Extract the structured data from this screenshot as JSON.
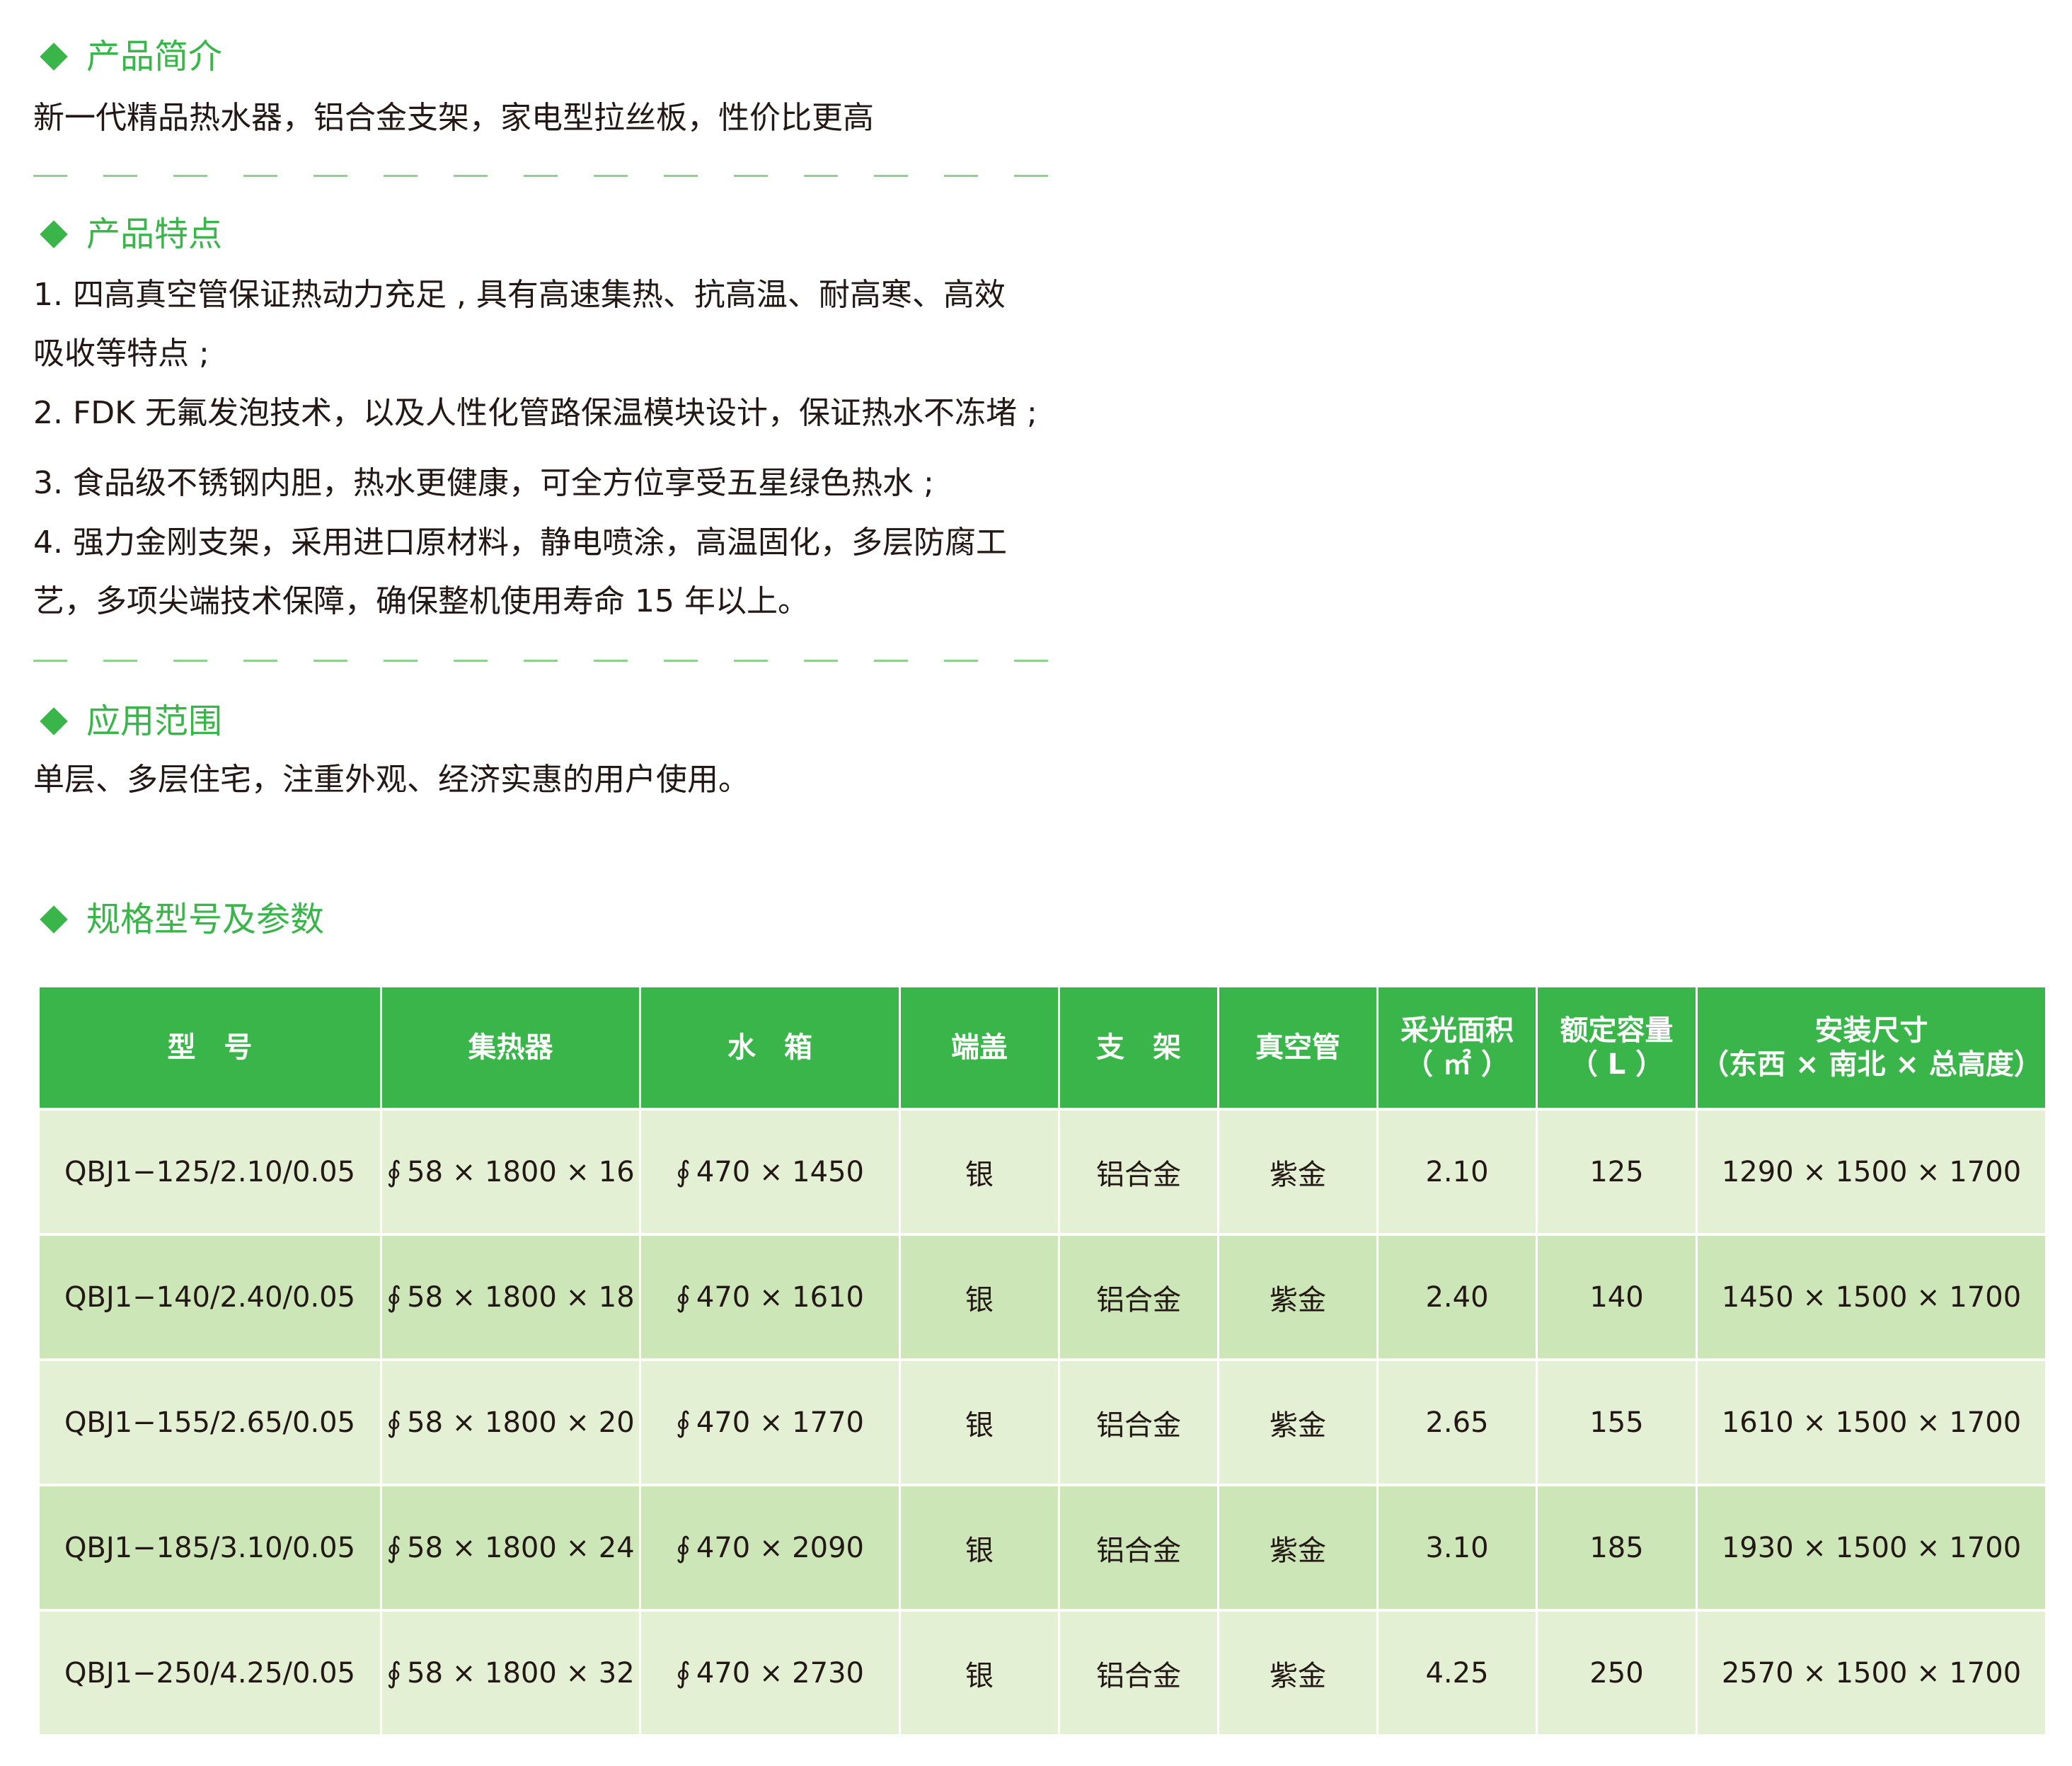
{
  "intro": {
    "title": "产品简介",
    "text": "新一代精品热水器，铝合金支架，家电型拉丝板，性价比更高"
  },
  "features": {
    "title": "产品特点",
    "lines": [
      "1. 四高真空管保证热动力充足 , 具有高速集热、抗高温、耐高寒、高效",
      "吸收等特点 ;",
      "2. FDK 无氟发泡技术，以及人性化管路保温模块设计，保证热水不冻堵 ;",
      "3. 食品级不锈钢内胆，热水更健康，可全方位享受五星绿色热水 ;",
      "4. 强力金刚支架，采用进口原材料，静电喷涂，高温固化，多层防腐工",
      "艺，多项尖端技术保障，确保整机使用寿命 15 年以上。"
    ]
  },
  "scope": {
    "title": "应用范围",
    "text": "单层、多层住宅，注重外观、经济实惠的用户使用。"
  },
  "specs": {
    "title": "规格型号及参数",
    "phi_symbol": "∮",
    "headers": [
      {
        "l1": "型　号",
        "l2": ""
      },
      {
        "l1": "集热器",
        "l2": ""
      },
      {
        "l1": "水　箱",
        "l2": ""
      },
      {
        "l1": "端盖",
        "l2": ""
      },
      {
        "l1": "支　架",
        "l2": ""
      },
      {
        "l1": "真空管",
        "l2": ""
      },
      {
        "l1": "采光面积",
        "l2": "（ ㎡ ）"
      },
      {
        "l1": "额定容量",
        "l2": "（ L ）"
      },
      {
        "l1": "安装尺寸",
        "l2": "（东西 × 南北 × 总高度）"
      }
    ],
    "rows": [
      {
        "model": "QBJ1−125/2.10/0.05",
        "collector": "58 × 1800 × 16",
        "tank": "470 × 1450",
        "cap": "银",
        "bracket": "铝合金",
        "tube": "紫金",
        "area": "2.10",
        "capacity": "125",
        "size": "1290 × 1500 × 1700"
      },
      {
        "model": "QBJ1−140/2.40/0.05",
        "collector": "58 × 1800 × 18",
        "tank": "470 × 1610",
        "cap": "银",
        "bracket": "铝合金",
        "tube": "紫金",
        "area": "2.40",
        "capacity": "140",
        "size": "1450 × 1500 × 1700"
      },
      {
        "model": "QBJ1−155/2.65/0.05",
        "collector": "58 × 1800 × 20",
        "tank": "470 × 1770",
        "cap": "银",
        "bracket": "铝合金",
        "tube": "紫金",
        "area": "2.65",
        "capacity": "155",
        "size": "1610 × 1500 × 1700"
      },
      {
        "model": "QBJ1−185/3.10/0.05",
        "collector": "58 × 1800 × 24",
        "tank": "470 × 2090",
        "cap": "银",
        "bracket": "铝合金",
        "tube": "紫金",
        "area": "3.10",
        "capacity": "185",
        "size": "1930 × 1500 × 1700"
      },
      {
        "model": "QBJ1−250/4.25/0.05",
        "collector": "58 × 1800 × 32",
        "tank": "470 × 2730",
        "cap": "银",
        "bracket": "铝合金",
        "tube": "紫金",
        "area": "4.25",
        "capacity": "250",
        "size": "2570 × 1500 × 1700"
      }
    ]
  },
  "colors": {
    "accent_green": "#39b54a",
    "row_light": "#e4f0d4",
    "row_dark": "#cde6b8",
    "divider": "#8ed18f"
  }
}
